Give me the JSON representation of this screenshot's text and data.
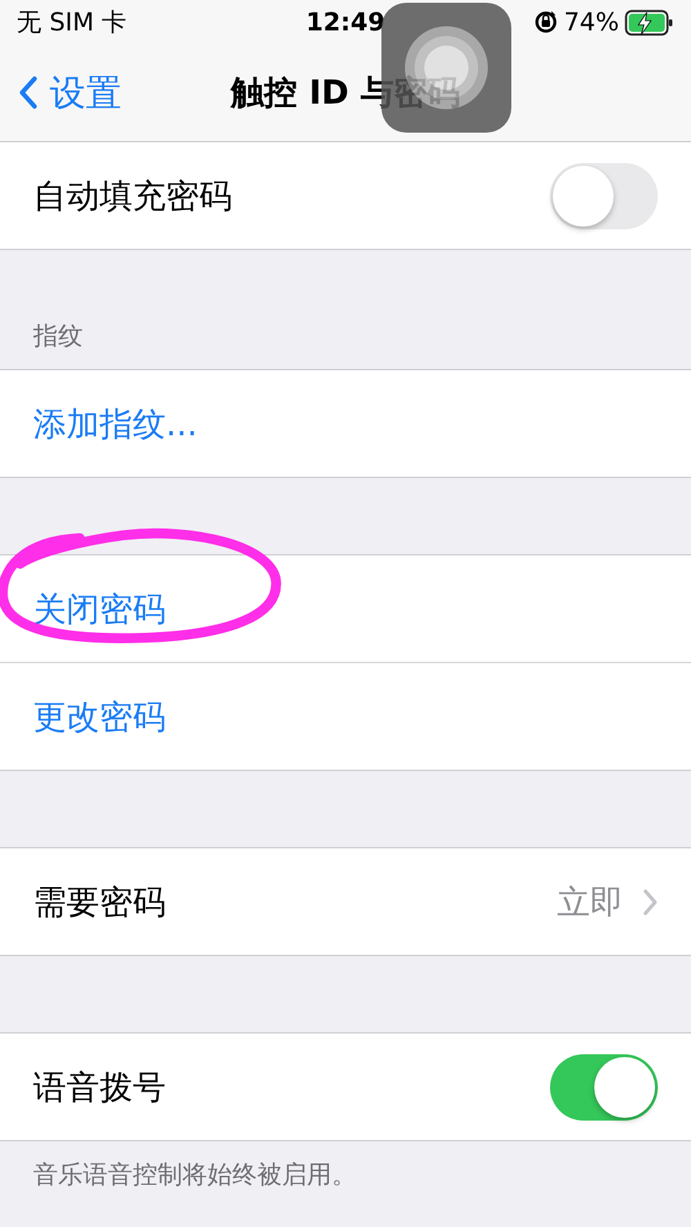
{
  "status_bar": {
    "carrier": "无 SIM 卡",
    "time": "12:49",
    "battery": "74%",
    "charging": true
  },
  "nav": {
    "back": "设置",
    "title": "触控 ID 与密码"
  },
  "sections": [
    {
      "rows": [
        {
          "kind": "toggle",
          "label": "自动填充密码",
          "on": false
        }
      ]
    },
    {
      "header": "指纹",
      "rows": [
        {
          "kind": "action",
          "label": "添加指纹...",
          "circled": false
        }
      ]
    },
    {
      "rows": [
        {
          "kind": "action",
          "label": "关闭密码",
          "circled": true
        },
        {
          "kind": "action",
          "label": "更改密码",
          "circled": false
        }
      ]
    },
    {
      "rows": [
        {
          "kind": "detail",
          "label": "需要密码",
          "value": "立即"
        }
      ]
    },
    {
      "rows": [
        {
          "kind": "toggle",
          "label": "语音拨号",
          "on": true
        }
      ],
      "footer": "音乐语音控制将始终被启用。"
    }
  ]
}
